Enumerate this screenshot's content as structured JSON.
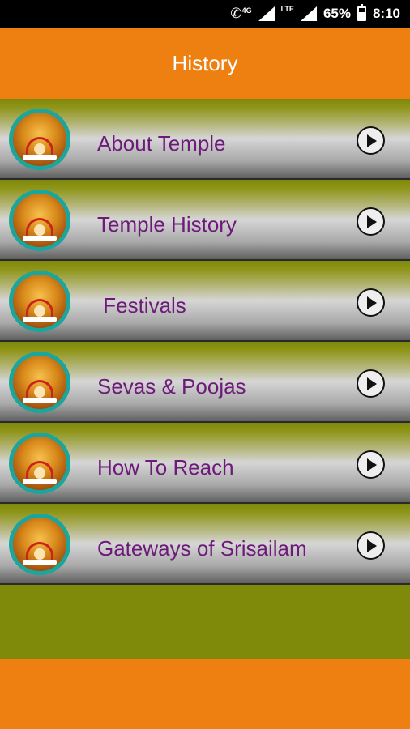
{
  "status_bar": {
    "network_label": "4G",
    "lte_label": "LTE",
    "battery": "65%",
    "time": "8:10"
  },
  "app_bar": {
    "title": "History"
  },
  "menu": {
    "items": [
      {
        "label": "About Temple"
      },
      {
        "label": "Temple History"
      },
      {
        "label": " Festivals"
      },
      {
        "label": "Sevas & Poojas"
      },
      {
        "label": "How To Reach"
      },
      {
        "label": "Gateways of Srisailam"
      }
    ]
  },
  "colors": {
    "accent": "#ee8012",
    "background": "#7f8a0b",
    "label_text": "#6e1a7a",
    "thumbnail_ring": "#1aa69c"
  }
}
